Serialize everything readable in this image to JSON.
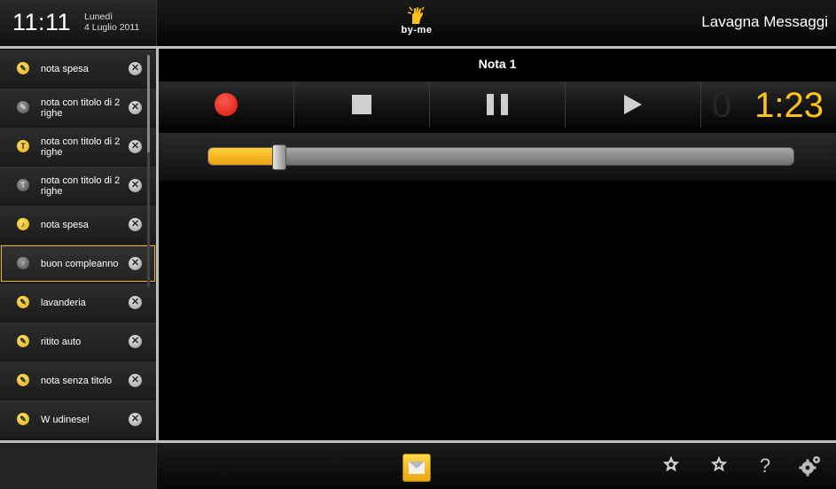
{
  "header": {
    "time": "11:11",
    "day": "Lunedì",
    "date": "4 Luglio 2011",
    "logo_text": "by-me",
    "app_title": "Lavagna Messaggi"
  },
  "sidebar": {
    "items": [
      {
        "label": "nota spesa",
        "icon": "pencil-icon",
        "icon_color": "yellow",
        "selected": false
      },
      {
        "label": "nota con titolo di 2 righe",
        "icon": "pencil-icon",
        "icon_color": "grey",
        "selected": false
      },
      {
        "label": "nota con titolo di 2 righe",
        "icon": "text-icon",
        "icon_color": "yellow",
        "selected": false
      },
      {
        "label": "nota con titolo di 2 righe",
        "icon": "text-icon",
        "icon_color": "grey",
        "selected": false
      },
      {
        "label": "nota spesa",
        "icon": "audio-icon",
        "icon_color": "yellow",
        "selected": false
      },
      {
        "label": "buon compleanno",
        "icon": "audio-icon",
        "icon_color": "grey",
        "selected": true
      },
      {
        "label": "lavanderia",
        "icon": "pencil-icon",
        "icon_color": "yellow",
        "selected": false
      },
      {
        "label": "ritito auto",
        "icon": "pencil-icon",
        "icon_color": "yellow",
        "selected": false
      },
      {
        "label": "nota senza titolo",
        "icon": "pencil-icon",
        "icon_color": "yellow",
        "selected": false
      },
      {
        "label": "W udinese!",
        "icon": "pencil-icon",
        "icon_color": "yellow",
        "selected": false
      }
    ],
    "delete_glyph": "✕"
  },
  "player": {
    "note_title": "Nota 1",
    "counter_ghost": "0",
    "counter_time": "1:23",
    "progress": 0.12,
    "buttons": [
      "record-button",
      "stop-button",
      "pause-button",
      "play-button"
    ]
  },
  "footer": {
    "icons": [
      "star-filled-icon",
      "star-outline-icon",
      "help-icon",
      "settings-icon"
    ],
    "help_glyph": "?"
  },
  "colors": {
    "accent": "#ffc21a",
    "record": "#e8170c",
    "selected_outline": "#e3b21e"
  }
}
